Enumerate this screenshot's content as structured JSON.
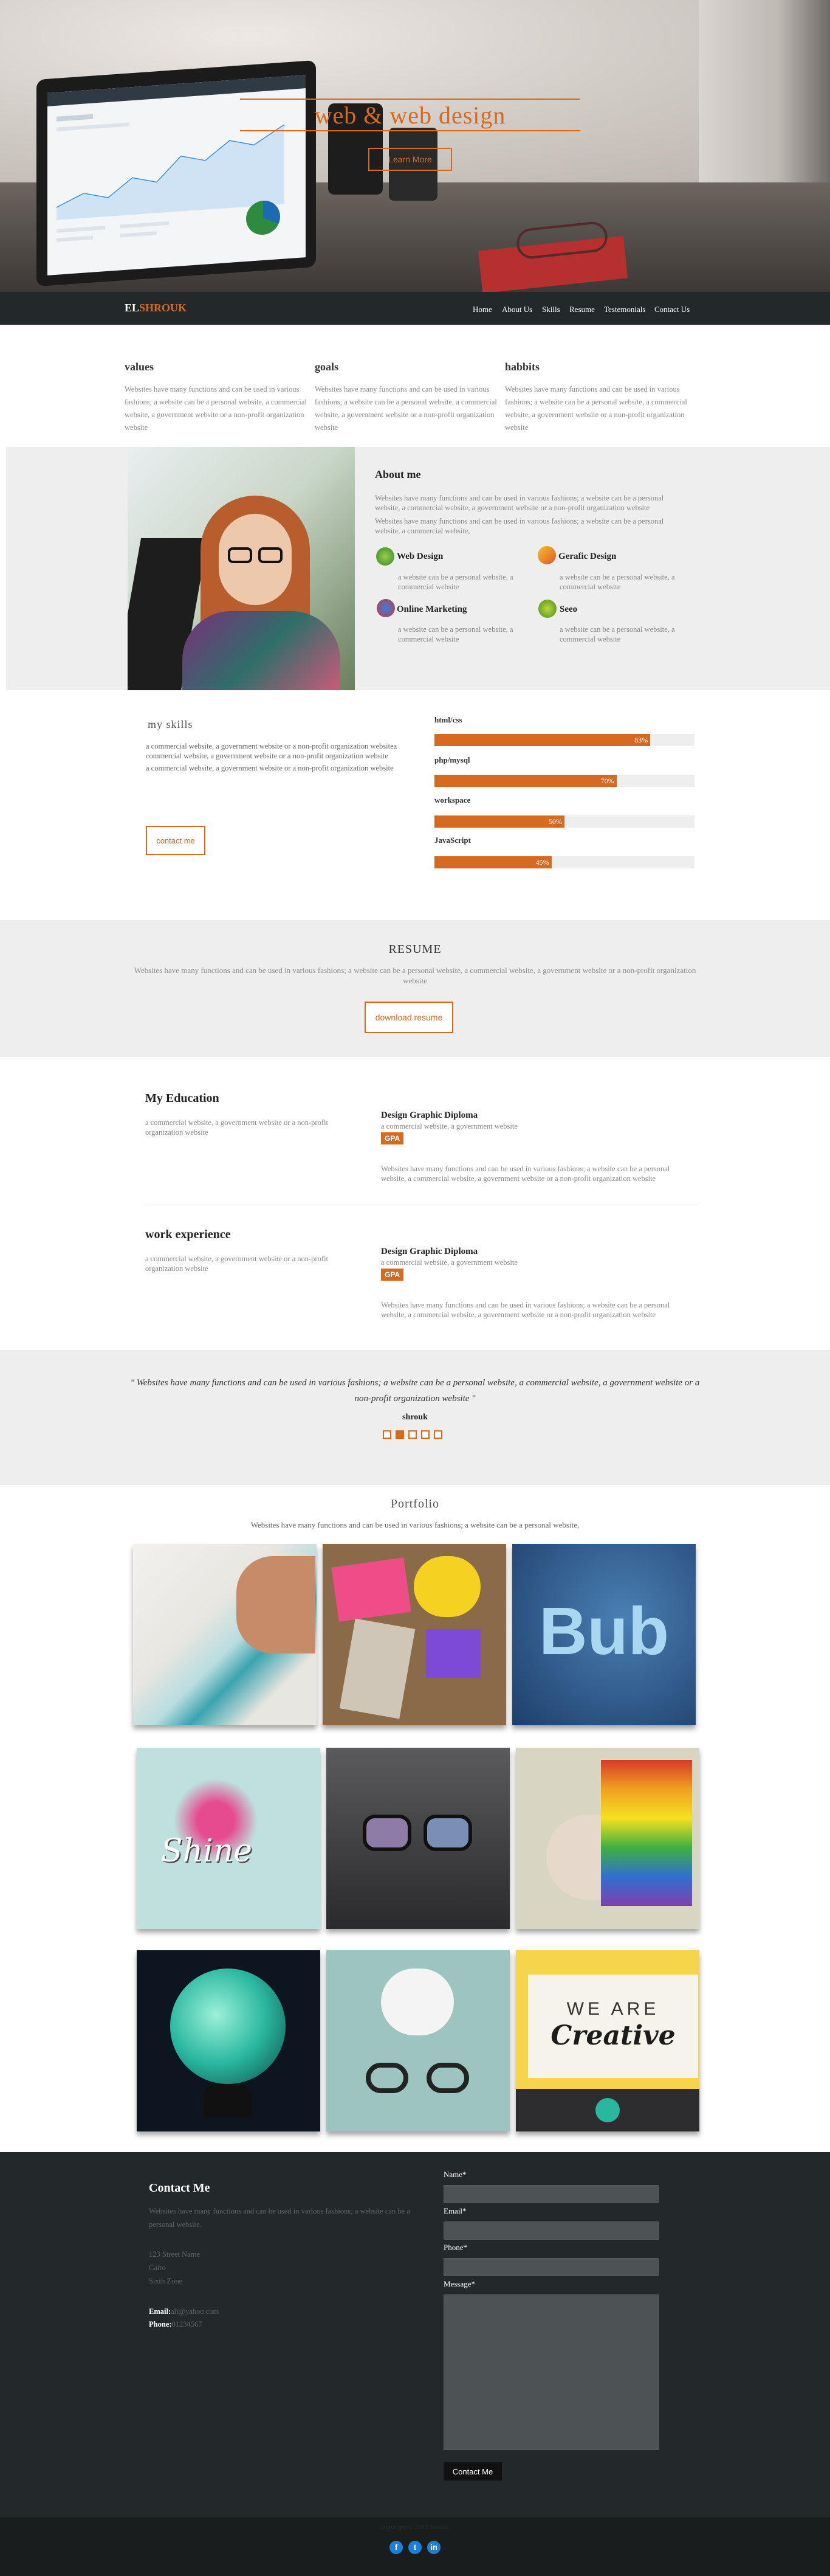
{
  "hero": {
    "title": "web & web design",
    "button": "Learn More"
  },
  "nav": {
    "brand": "ELSHROUK",
    "links": [
      "Home",
      "About Us",
      "Skills",
      "Resume",
      "Testemonials",
      "Contact Us"
    ]
  },
  "values": [
    {
      "title": "values",
      "text": "Websites have many functions and can be used in various fashions; a website can be a personal website, a commercial website, a government website or a non-profit organization website"
    },
    {
      "title": "goals",
      "text": "Websites have many functions and can be used in various fashions; a website can be a personal website, a commercial website, a government website or a non-profit organization website"
    },
    {
      "title": "habbits",
      "text": "Websites have many functions and can be used in various fashions; a website can be a personal website, a commercial website, a government website or a non-profit organization website"
    }
  ],
  "about": {
    "title": "About me",
    "p1": "Websites have many functions and can be used in various fashions; a website can be a personal website, a commercial website, a government website or a non-profit organization website",
    "p2": "Websites have many functions and can be used in various fashions; a website can be a personal website, a commercial website,",
    "services": [
      {
        "title": "Web Design",
        "text": "a website can be a personal website, a commercial website"
      },
      {
        "title": "Gerafic Design",
        "text": "a website can be a personal website, a commercial website"
      },
      {
        "title": "Online Marketing",
        "text": "a website can be a personal website, a commercial website"
      },
      {
        "title": "Seeo",
        "text": "a website can be a personal website, a commercial website"
      }
    ]
  },
  "skills": {
    "title": "my skills",
    "p1": "a commercial website, a government website or a non-profit organization websitea commercial website, a government website or a non-profit organization website",
    "p2": "a commercial website, a government website or a non-profit organization website",
    "button": "contact me",
    "bars": [
      {
        "label": "html/css",
        "value": 83,
        "text": "83%"
      },
      {
        "label": "php/mysql",
        "value": 70,
        "text": "70%"
      },
      {
        "label": "workspace",
        "value": 50,
        "text": "50%"
      },
      {
        "label": "JavaScript",
        "value": 45,
        "text": "45%"
      }
    ]
  },
  "resume": {
    "title": "RESUME",
    "text": "Websites have many functions and can be used in various fashions; a website can be a personal website, a commercial website, a government website or a non-profit organization website",
    "button": "download resume",
    "education": {
      "title": "My Education",
      "sub": "a commercial website, a government website or a non-profit organization website",
      "degree": "Design Graphic Diploma",
      "degree_sub": "a commercial website, a government website",
      "badge": "GPA",
      "text": "Websites have many functions and can be used in various fashions; a website can be a personal website, a commercial website, a government website or a non-profit organization website"
    },
    "experience": {
      "title": "work experience",
      "sub": "a commercial website, a government website or a non-profit organization website",
      "degree": "Design Graphic Diploma",
      "degree_sub": "a commercial website, a government website",
      "badge": "GPA",
      "text": "Websites have many functions and can be used in various fashions; a website can be a personal website, a commercial website, a government website or a non-profit organization website"
    }
  },
  "testimonial": {
    "quote": "\" Websites have many functions and can be used in various fashions; a website can be a personal website, a commercial website, a government website or a non-profit organization website \"",
    "name": "shrouk",
    "active_dot": 1,
    "dot_count": 5
  },
  "portfolio": {
    "title": "Portfolio",
    "text": "Websites have many functions and can be used in various fashions; a website can be a personal website,",
    "items": [
      {
        "name": "watercolor-sketch"
      },
      {
        "name": "colorful-cards"
      },
      {
        "name": "bub-lettering",
        "text": "Bub"
      },
      {
        "name": "shine-illustration",
        "text": "Shine"
      },
      {
        "name": "glasses-portrait"
      },
      {
        "name": "rainbow-brain"
      },
      {
        "name": "death-star-lamp"
      },
      {
        "name": "idea-bubbles"
      },
      {
        "name": "we-are-creative",
        "line1": "WE ARE",
        "line2": "Creative"
      }
    ]
  },
  "contact": {
    "title": "Contact Me",
    "text": "Websites have many functions and can be used in various fashions; a website can be a personal website.",
    "address": [
      "123 Street Name",
      "Cairo",
      "Sixth Zone"
    ],
    "email_label": "Email:",
    "email": "ali@yahoo.com",
    "phone_label": "Phone:",
    "phone": "01234567",
    "form": {
      "name_label": "Name*",
      "email_label": "Email*",
      "phone_label": "Phone*",
      "message_label": "Message*",
      "button": "Contact Me"
    }
  },
  "footer": {
    "copyright": "copyright © 2015 Shrouk",
    "social": [
      {
        "icon": "facebook-icon",
        "glyph": "f"
      },
      {
        "icon": "twitter-icon",
        "glyph": "t"
      },
      {
        "icon": "linkedin-icon",
        "glyph": "in"
      }
    ]
  },
  "colors": {
    "accent": "#d66a20",
    "dark": "#23292b",
    "band": "#eeeeee"
  }
}
